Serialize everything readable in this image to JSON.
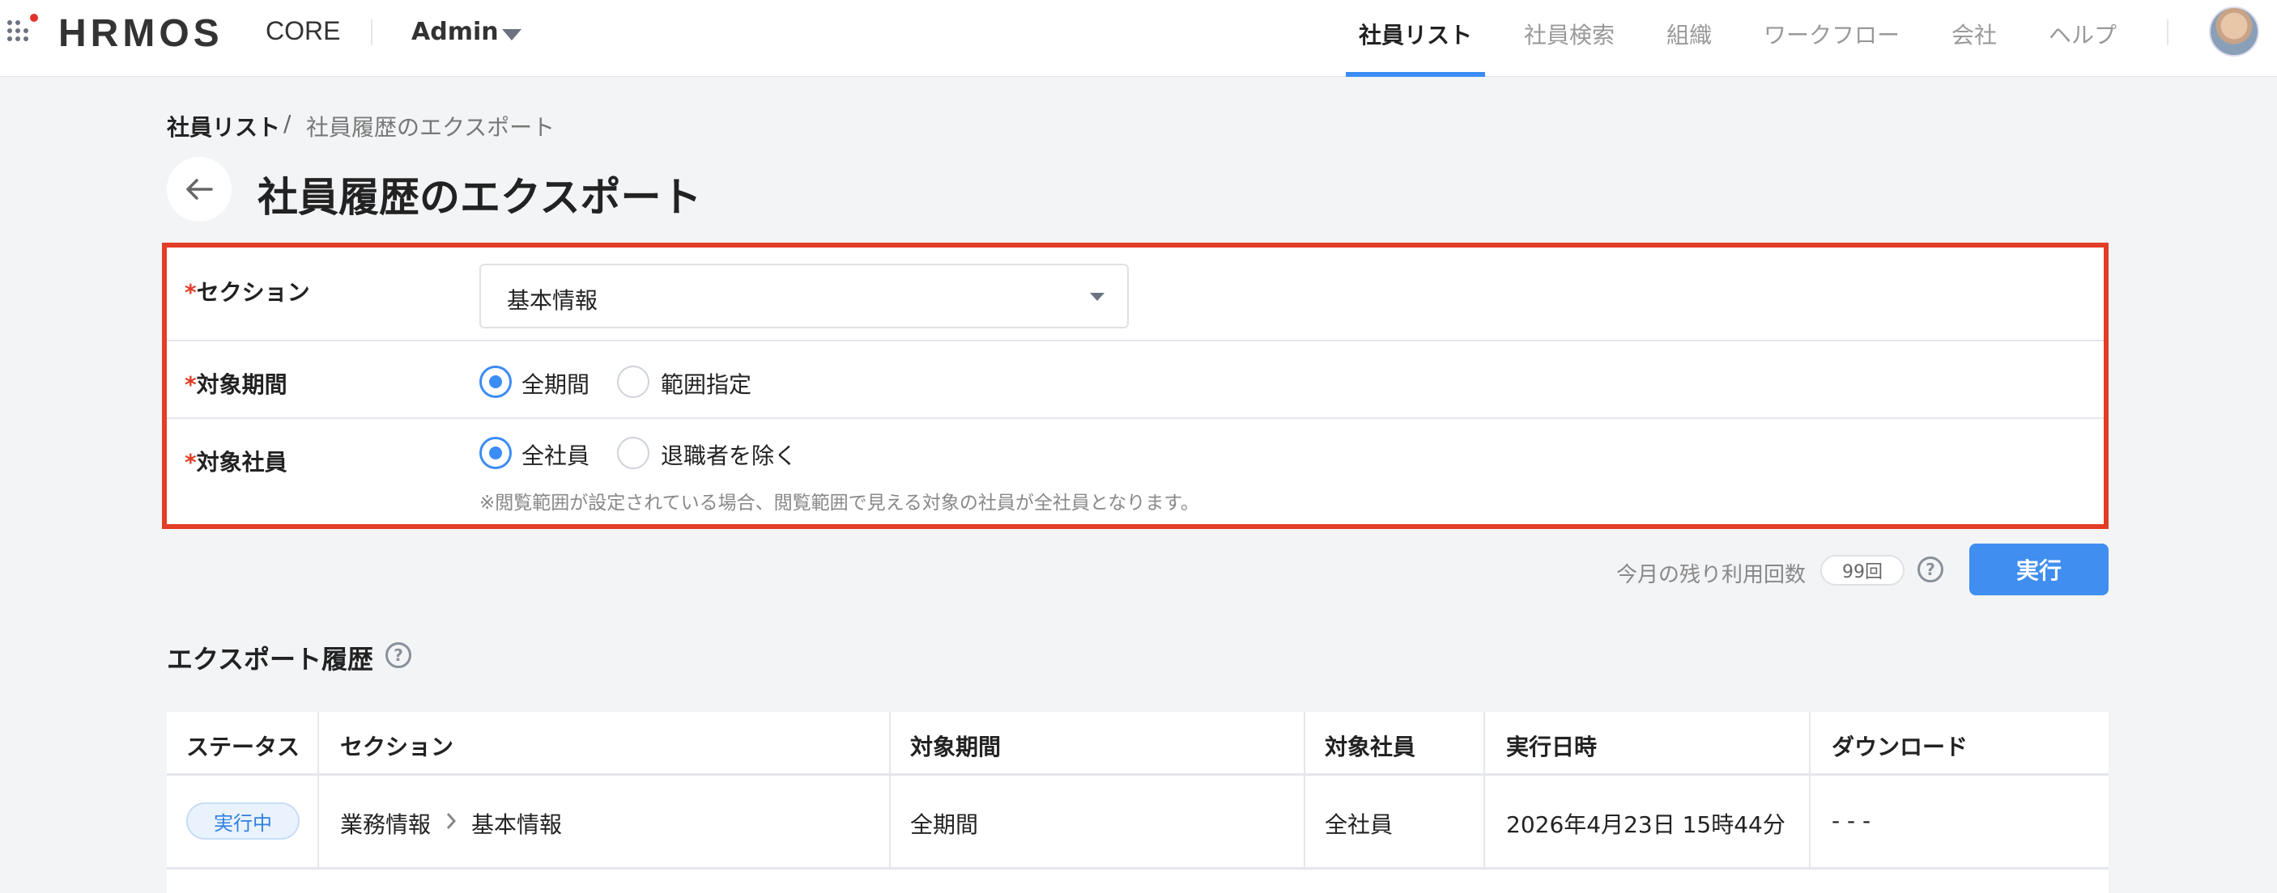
{
  "header": {
    "logo": "HRMOS",
    "product": "CORE",
    "role": "Admin",
    "nav": [
      "社員リスト",
      "社員検索",
      "組織",
      "ワークフロー",
      "会社",
      "ヘルプ"
    ],
    "active_nav": "社員リスト"
  },
  "breadcrumb": {
    "root": "社員リスト",
    "sep": "/",
    "current": "社員履歴のエクスポート"
  },
  "page": {
    "title": "社員履歴のエクスポート"
  },
  "form": {
    "required_mark": "*",
    "section": {
      "label": "セクション",
      "value": "基本情報"
    },
    "period": {
      "label": "対象期間",
      "options": [
        "全期間",
        "範囲指定"
      ],
      "selected": "全期間"
    },
    "employees": {
      "label": "対象社員",
      "options": [
        "全社員",
        "退職者を除く"
      ],
      "selected": "全社員",
      "note": "※閲覧範囲が設定されている場合、閲覧範囲で見える対象の社員が全社員となります。"
    }
  },
  "execute": {
    "remaining_label": "今月の残り利用回数",
    "remaining_count": "99回",
    "button": "実行"
  },
  "history": {
    "title": "エクスポート履歴",
    "columns": [
      "ステータス",
      "セクション",
      "対象期間",
      "対象社員",
      "実行日時",
      "ダウンロード"
    ],
    "rows": [
      {
        "status": "実行中",
        "section_parent": "業務情報",
        "section_child": "基本情報",
        "period": "全期間",
        "employees": "全社員",
        "datetime": "2026年4月23日 15時44分",
        "download": "- - -"
      }
    ]
  },
  "colors": {
    "accent": "#3b8cf5",
    "highlight_border": "#e23d26",
    "logo_dot": "#e0322b"
  }
}
